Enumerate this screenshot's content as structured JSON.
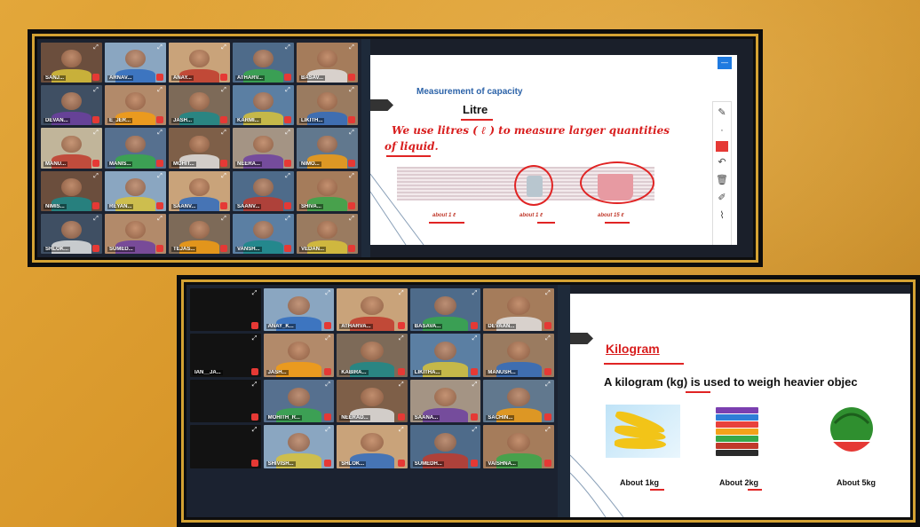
{
  "session1": {
    "participants": [
      {
        "name": "SANJ..."
      },
      {
        "name": "ARNAV..."
      },
      {
        "name": "ANAY..."
      },
      {
        "name": "ATHARV..."
      },
      {
        "name": "BASAV..."
      },
      {
        "name": "DEVAN..."
      },
      {
        "name": "E_JER..."
      },
      {
        "name": "JASH..."
      },
      {
        "name": "KARMI..."
      },
      {
        "name": "LIKITH..."
      },
      {
        "name": "MANU..."
      },
      {
        "name": "MANIS..."
      },
      {
        "name": "MOHIT..."
      },
      {
        "name": "NEERA..."
      },
      {
        "name": "NIMO..."
      },
      {
        "name": "NIMIS..."
      },
      {
        "name": "REYAN..."
      },
      {
        "name": "SAANV..."
      },
      {
        "name": "SAANV..."
      },
      {
        "name": "SHIVA..."
      },
      {
        "name": "SHLOK..."
      },
      {
        "name": "SUMED..."
      },
      {
        "name": "TEJAS..."
      },
      {
        "name": "VANSH..."
      },
      {
        "name": "VEDAN..."
      }
    ],
    "slide": {
      "title": "Measurement of capacity",
      "subtitle": "Litre",
      "handwriting_line1": "We use litres ( ℓ ) to measure larger quantities",
      "handwriting_line2": "of liquid.",
      "captions": [
        "about 1 ℓ",
        "about 1 ℓ",
        "about 15 ℓ"
      ]
    }
  },
  "session2": {
    "participants": [
      {
        "name": ""
      },
      {
        "name": "ANAY_K..."
      },
      {
        "name": "ATHARVA..."
      },
      {
        "name": "BASAVA..."
      },
      {
        "name": "DEVAAN..."
      },
      {
        "name": "IAN__JA..."
      },
      {
        "name": "JASH..."
      },
      {
        "name": "KABIRA..."
      },
      {
        "name": "LIKITHA..."
      },
      {
        "name": "MANUSH..."
      },
      {
        "name": ""
      },
      {
        "name": "MOHITH_R..."
      },
      {
        "name": "NEERAD..."
      },
      {
        "name": "SAANA..."
      },
      {
        "name": "SACHIN..."
      },
      {
        "name": ""
      },
      {
        "name": "SHIVISH..."
      },
      {
        "name": "SHLOK..."
      },
      {
        "name": "SUMEDH..."
      },
      {
        "name": "VAISHNA..."
      }
    ],
    "slide": {
      "title": "Kilogram",
      "text": "A kilogram (kg) is used to weigh heavier objec",
      "captions": [
        "About 1kg",
        "About 2kg",
        "About 5kg"
      ]
    }
  },
  "toolbar": {
    "icons": [
      "pencil-icon",
      "color-swatch-icon",
      "undo-icon",
      "trash-icon",
      "pen-icon",
      "chart-icon"
    ]
  },
  "colors": {
    "background": "#d9982b",
    "frame_gold": "#d4a233",
    "handwriting_red": "#d81e1e",
    "slide_title_blue": "#2b62a8"
  }
}
